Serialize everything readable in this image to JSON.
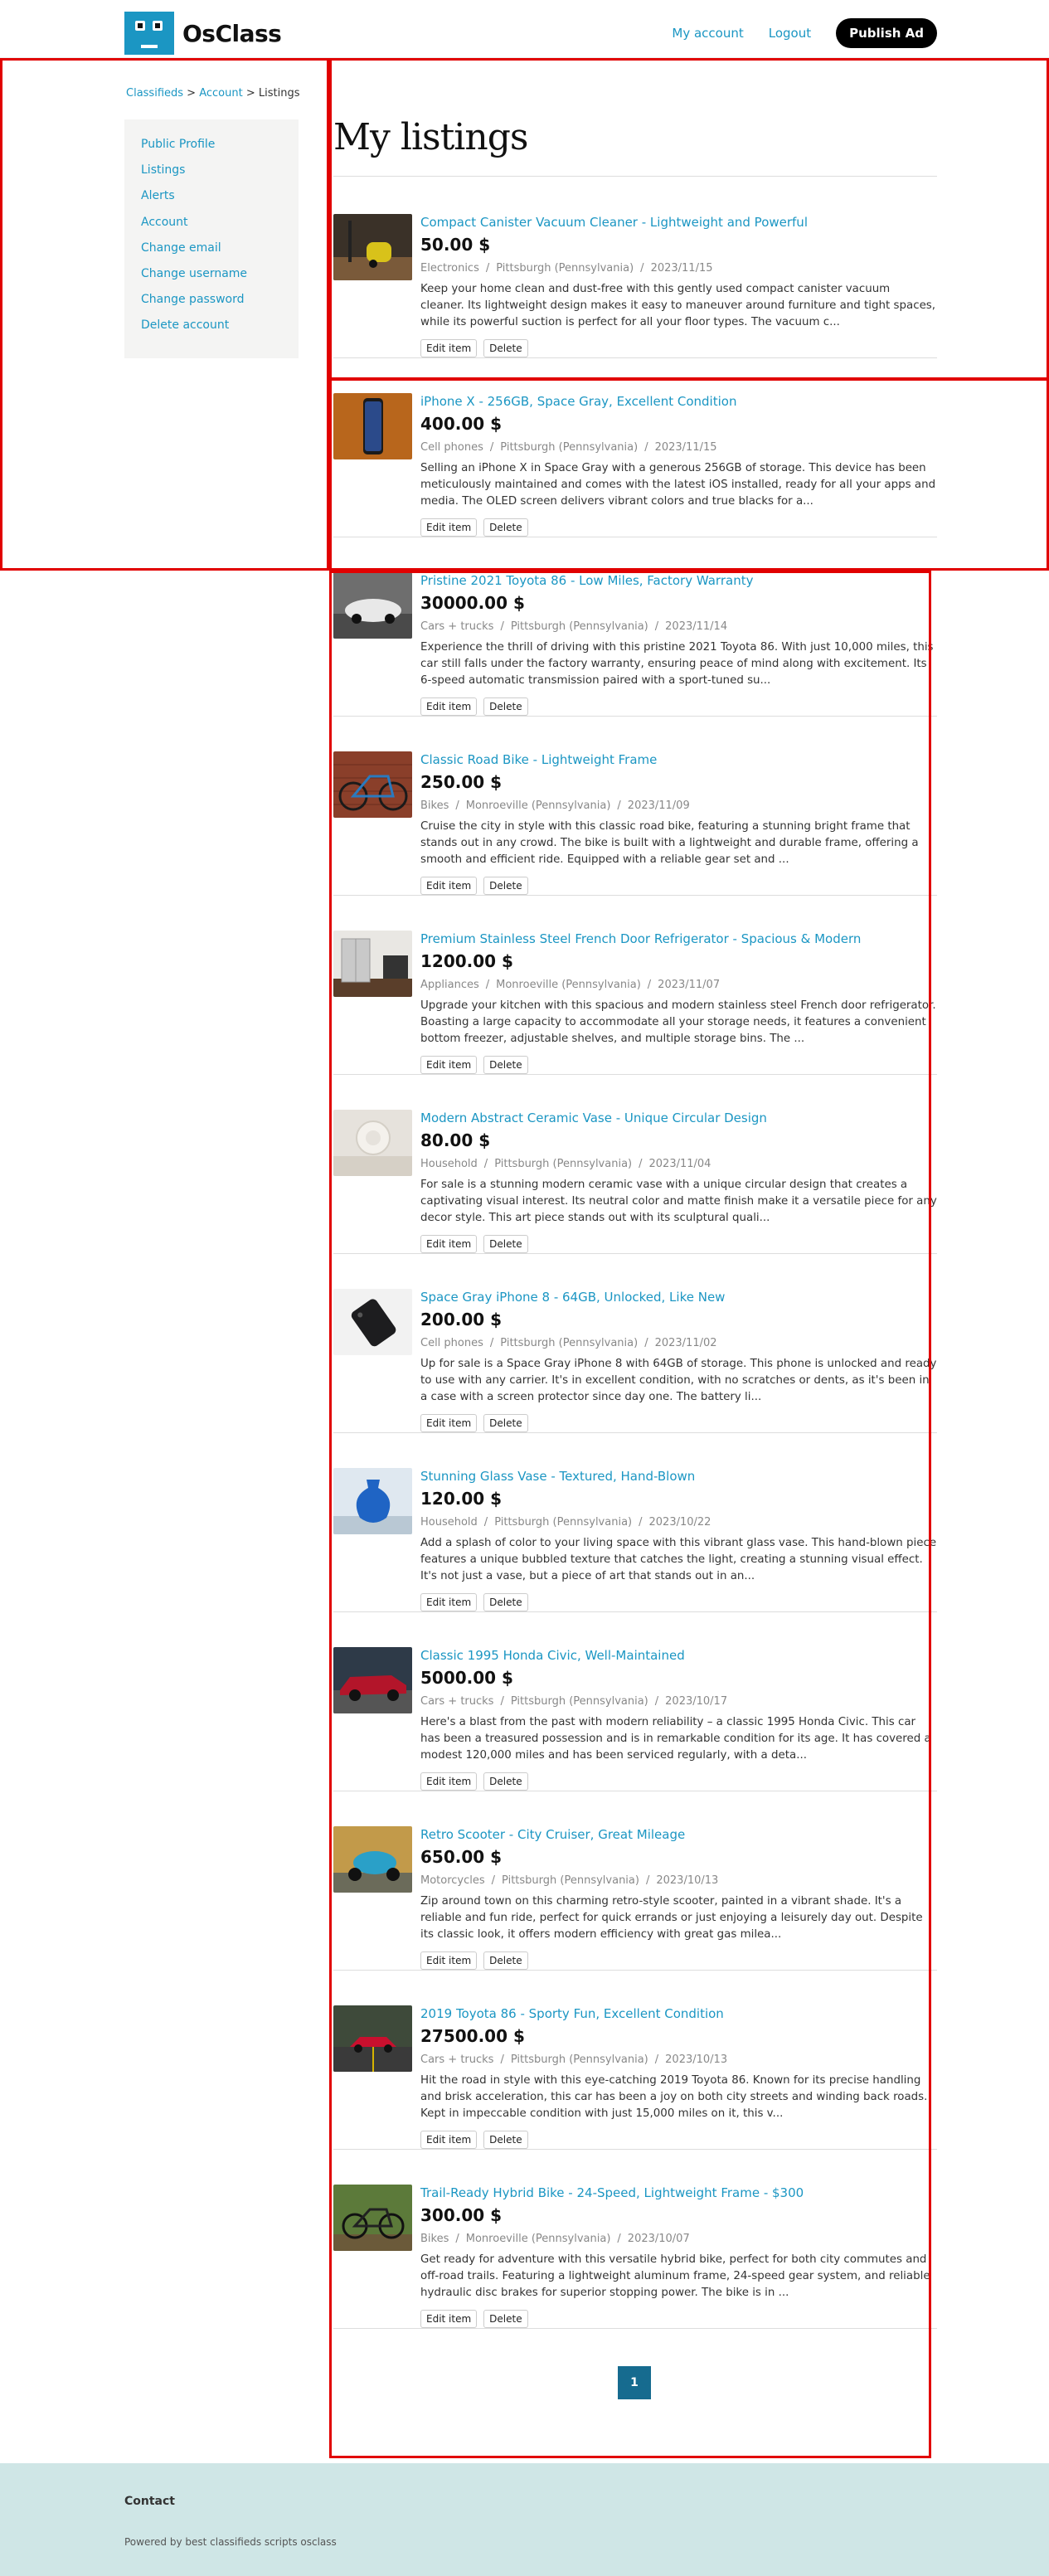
{
  "header": {
    "logo_text": "OsClass",
    "nav": {
      "account": "My account",
      "logout": "Logout",
      "publish": "Publish Ad"
    }
  },
  "breadcrumb": {
    "home": "Classifieds",
    "sep": " > ",
    "account": "Account",
    "current": "Listings"
  },
  "sidebar": {
    "items": [
      {
        "label": "Public Profile"
      },
      {
        "label": "Listings"
      },
      {
        "label": "Alerts"
      },
      {
        "label": "Account"
      },
      {
        "label": "Change email"
      },
      {
        "label": "Change username"
      },
      {
        "label": "Change password"
      },
      {
        "label": "Delete account"
      }
    ]
  },
  "page_title": "My listings",
  "buttons": {
    "edit": "Edit item",
    "delete": "Delete"
  },
  "listings": [
    {
      "title": "Compact Canister Vacuum Cleaner - Lightweight and Powerful",
      "price": "50.00 $",
      "category": "Electronics",
      "location": "Pittsburgh (Pennsylvania)",
      "date": "2023/11/15",
      "desc": "Keep your home clean and dust-free with this gently used compact canister vacuum cleaner. Its lightweight design makes it easy to maneuver around furniture and tight spaces, while its powerful suction is perfect for all your floor types. The vacuum c..."
    },
    {
      "title": "iPhone X - 256GB, Space Gray, Excellent Condition",
      "price": "400.00 $",
      "category": "Cell phones",
      "location": "Pittsburgh (Pennsylvania)",
      "date": "2023/11/15",
      "desc": "Selling an iPhone X in Space Gray with a generous 256GB of storage. This device has been meticulously maintained and comes with the latest iOS installed, ready for all your apps and media. The OLED screen delivers vibrant colors and true blacks for a..."
    },
    {
      "title": "Pristine 2021 Toyota 86 - Low Miles, Factory Warranty",
      "price": "30000.00 $",
      "category": "Cars + trucks",
      "location": "Pittsburgh (Pennsylvania)",
      "date": "2023/11/14",
      "desc": "Experience the thrill of driving with this pristine 2021 Toyota 86. With just 10,000 miles, this car still falls under the factory warranty, ensuring peace of mind along with excitement. Its 6-speed automatic transmission paired with a sport-tuned su..."
    },
    {
      "title": "Classic Road Bike - Lightweight Frame",
      "price": "250.00 $",
      "category": "Bikes",
      "location": "Monroeville (Pennsylvania)",
      "date": "2023/11/09",
      "desc": "Cruise the city in style with this classic road bike, featuring a stunning bright frame that stands out in any crowd. The bike is built with a lightweight and durable frame, offering a smooth and efficient ride. Equipped with a reliable gear set and ..."
    },
    {
      "title": "Premium Stainless Steel French Door Refrigerator - Spacious & Modern",
      "price": "1200.00 $",
      "category": "Appliances",
      "location": "Monroeville (Pennsylvania)",
      "date": "2023/11/07",
      "desc": "Upgrade your kitchen with this spacious and modern stainless steel French door refrigerator. Boasting a large capacity to accommodate all your storage needs, it features a convenient bottom freezer, adjustable shelves, and multiple storage bins. The ..."
    },
    {
      "title": "Modern Abstract Ceramic Vase - Unique Circular Design",
      "price": "80.00 $",
      "category": "Household",
      "location": "Pittsburgh (Pennsylvania)",
      "date": "2023/11/04",
      "desc": "For sale is a stunning modern ceramic vase with a unique circular design that creates a captivating visual interest. Its neutral color and matte finish make it a versatile piece for any decor style. This art piece stands out with its sculptural quali..."
    },
    {
      "title": "Space Gray iPhone 8 - 64GB, Unlocked, Like New",
      "price": "200.00 $",
      "category": "Cell phones",
      "location": "Pittsburgh (Pennsylvania)",
      "date": "2023/11/02",
      "desc": "Up for sale is a Space Gray iPhone 8 with 64GB of storage. This phone is unlocked and ready to use with any carrier. It's in excellent condition, with no scratches or dents, as it's been in a case with a screen protector since day one. The battery li..."
    },
    {
      "title": "Stunning Glass Vase - Textured, Hand-Blown",
      "price": "120.00 $",
      "category": "Household",
      "location": "Pittsburgh (Pennsylvania)",
      "date": "2023/10/22",
      "desc": "Add a splash of color to your living space with this vibrant glass vase. This hand-blown piece features a unique bubbled texture that catches the light, creating a stunning visual effect. It's not just a vase, but a piece of art that stands out in an..."
    },
    {
      "title": "Classic 1995 Honda Civic, Well-Maintained",
      "price": "5000.00 $",
      "category": "Cars + trucks",
      "location": "Pittsburgh (Pennsylvania)",
      "date": "2023/10/17",
      "desc": "Here's a blast from the past with modern reliability – a classic 1995 Honda Civic. This car has been a treasured possession and is in remarkable condition for its age. It has covered a modest 120,000 miles and has been serviced regularly, with a deta..."
    },
    {
      "title": "Retro Scooter - City Cruiser, Great Mileage",
      "price": "650.00 $",
      "category": "Motorcycles",
      "location": "Pittsburgh (Pennsylvania)",
      "date": "2023/10/13",
      "desc": "Zip around town on this charming retro-style scooter, painted in a vibrant shade. It's a reliable and fun ride, perfect for quick errands or just enjoying a leisurely day out. Despite its classic look, it offers modern efficiency with great gas milea..."
    },
    {
      "title": "2019 Toyota 86 - Sporty Fun, Excellent Condition",
      "price": "27500.00 $",
      "category": "Cars + trucks",
      "location": "Pittsburgh (Pennsylvania)",
      "date": "2023/10/13",
      "desc": "Hit the road in style with this eye-catching 2019 Toyota 86. Known for its precise handling and brisk acceleration, this car has been a joy on both city streets and winding back roads. Kept in impeccable condition with just 15,000 miles on it, this v..."
    },
    {
      "title": "Trail-Ready Hybrid Bike - 24-Speed, Lightweight Frame - $300",
      "price": "300.00 $",
      "category": "Bikes",
      "location": "Monroeville (Pennsylvania)",
      "date": "2023/10/07",
      "desc": "Get ready for adventure with this versatile hybrid bike, perfect for both city commutes and off-road trails. Featuring a lightweight aluminum frame, 24-speed gear system, and reliable hydraulic disc brakes for superior stopping power. The bike is in ..."
    }
  ],
  "pagination": {
    "current": "1"
  },
  "footer": {
    "contact": "Contact",
    "powered": "Powered by best classifieds scripts osclass"
  },
  "colors": {
    "accent": "#1b96c3",
    "pagination": "#166b8f",
    "footer_bg": "#cfe6e6",
    "outline": "#e10000"
  }
}
